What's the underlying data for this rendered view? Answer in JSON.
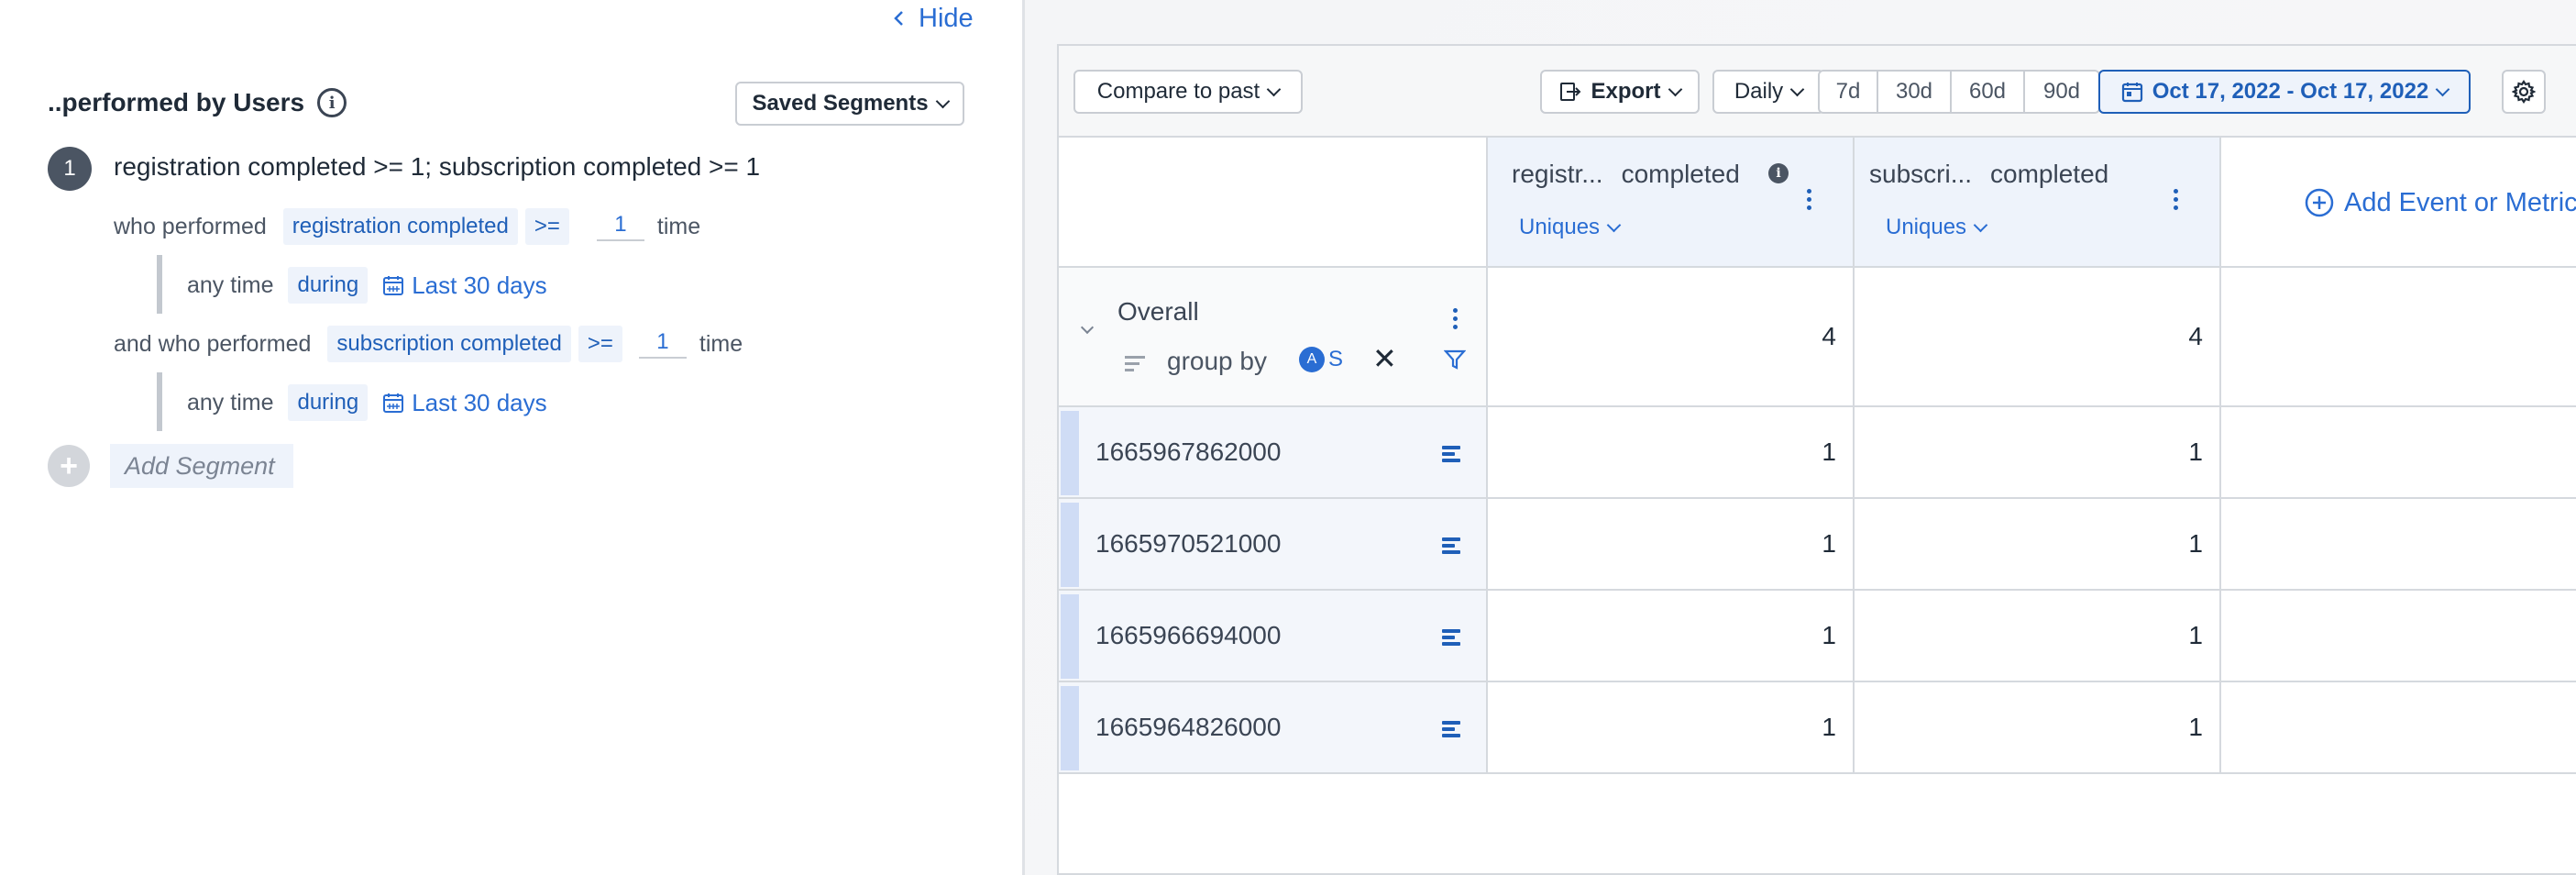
{
  "left_panel": {
    "hide_label": "Hide",
    "segment_title": "..performed by Users",
    "saved_segments_label": "Saved Segments",
    "segment": {
      "number": "1",
      "definition": "registration completed >= 1; subscription completed >= 1",
      "conditions": [
        {
          "prefix": "who performed",
          "event": "registration completed",
          "operator": ">=",
          "count": "1",
          "unit": "time",
          "timing_label": "any time",
          "during_label": "during",
          "range_label": "Last 30 days"
        },
        {
          "prefix": "and who performed",
          "event": "subscription completed",
          "operator": ">=",
          "count": "1",
          "unit": "time",
          "timing_label": "any time",
          "during_label": "during",
          "range_label": "Last 30 days"
        }
      ]
    },
    "add_segment_label": "Add Segment"
  },
  "toolbar": {
    "compare_label": "Compare to past",
    "export_label": "Export",
    "interval_label": "Daily",
    "ranges": [
      "7d",
      "30d",
      "60d",
      "90d"
    ],
    "date_range": "Oct 17, 2022 - Oct 17, 2022"
  },
  "table": {
    "columns": [
      {
        "name_a": "registr...",
        "name_b": "completed",
        "agg": "Uniques"
      },
      {
        "name_a": "subscri...",
        "name_b": "completed",
        "agg": "Uniques"
      }
    ],
    "add_event_label": "Add Event or Metric",
    "overall": {
      "label": "Overall",
      "group_by_label": "group by",
      "group_by_value": "S",
      "values": [
        "4",
        "4"
      ]
    },
    "rows": [
      {
        "label": "1665967862000",
        "values": [
          "1",
          "1"
        ]
      },
      {
        "label": "1665970521000",
        "values": [
          "1",
          "1"
        ]
      },
      {
        "label": "1665966694000",
        "values": [
          "1",
          "1"
        ]
      },
      {
        "label": "1665964826000",
        "values": [
          "1",
          "1"
        ]
      }
    ]
  },
  "colors": {
    "accent": "#2a6dd3",
    "header_bg": "#eef3fb",
    "border": "#d5d9de"
  }
}
